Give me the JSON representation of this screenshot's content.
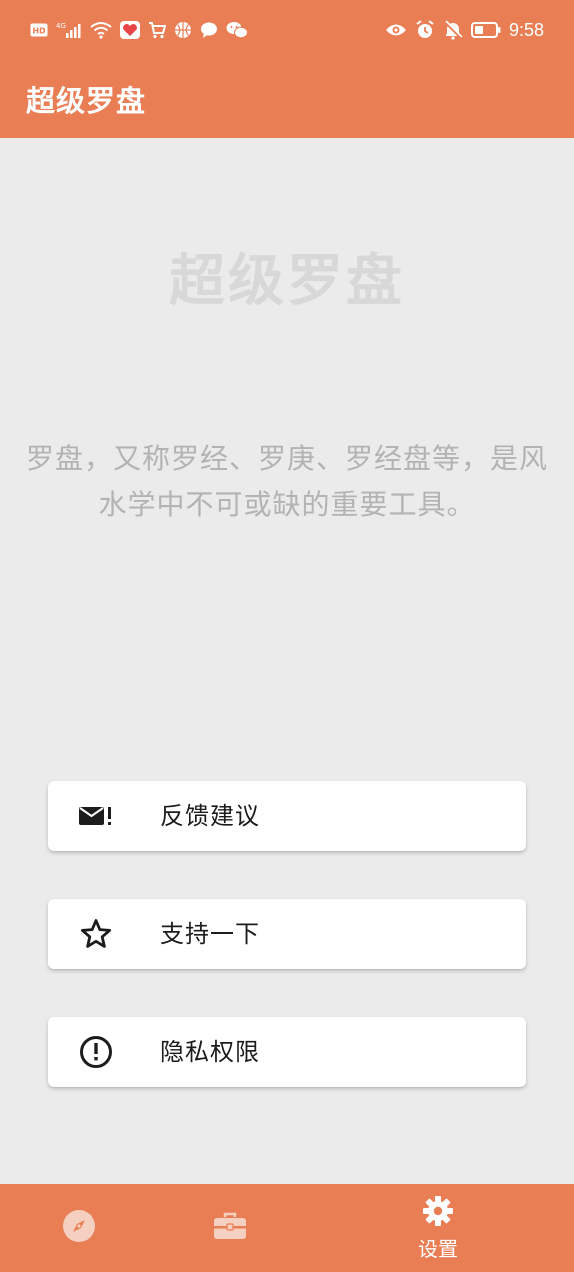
{
  "status_bar": {
    "left_icons": [
      "hd-icon",
      "signal-4g-icon",
      "wifi-icon",
      "health-app-icon",
      "shopping-cart-icon",
      "basketball-icon",
      "chat-bubble-icon",
      "wechat-icon"
    ],
    "right_icons": [
      "eye-icon",
      "alarm-icon",
      "mute-bell-icon",
      "battery-icon"
    ],
    "time": "9:58",
    "signal_label": "4G"
  },
  "app_bar": {
    "title": "超级罗盘"
  },
  "hero": {
    "title": "超级罗盘",
    "description": "罗盘，又称罗经、罗庚、罗经盘等，是风水学中不可或缺的重要工具。"
  },
  "actions": [
    {
      "label": "反馈建议",
      "icon": "mail-alert-icon"
    },
    {
      "label": "支持一下",
      "icon": "star-icon"
    },
    {
      "label": "隐私权限",
      "icon": "info-alert-icon"
    }
  ],
  "bottom_nav": {
    "items": [
      {
        "icon": "compass-icon",
        "label": ""
      },
      {
        "icon": "toolbox-icon",
        "label": ""
      },
      {
        "icon": "gear-icon",
        "label": "设置",
        "active": true
      }
    ]
  },
  "colors": {
    "accent": "#e97e55",
    "background": "#ebebeb",
    "card": "#ffffff",
    "hero_text": "#d8d8d8",
    "desc_text": "#b3b3b3"
  }
}
